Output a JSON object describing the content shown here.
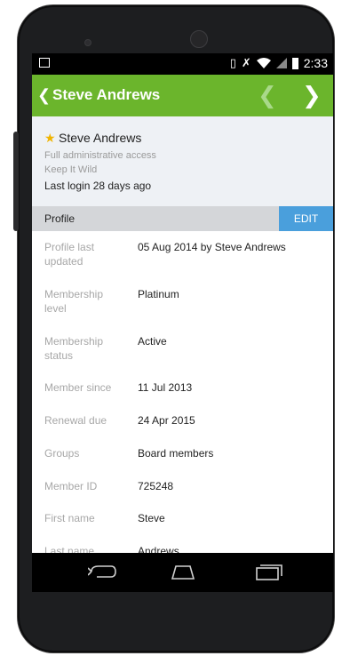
{
  "status_bar": {
    "time": "2:33"
  },
  "app_bar": {
    "back_glyph": "❮",
    "title": "Steve Andrews",
    "prev_glyph": "❮",
    "next_glyph": "❯",
    "color": "#6bb52c"
  },
  "user_card": {
    "star_icon": "star-icon",
    "star_color": "#f0b400",
    "name": "Steve Andrews",
    "access": "Full administrative access",
    "organization": "Keep It Wild",
    "last_login": "Last login 28 days ago"
  },
  "section": {
    "title": "Profile",
    "edit_label": "EDIT",
    "edit_color": "#4a9fdc"
  },
  "profile_rows": [
    {
      "label": "Profile last updated",
      "value": "05 Aug 2014 by Steve Andrews"
    },
    {
      "label": "Membership level",
      "value": "Platinum"
    },
    {
      "label": "Membership status",
      "value": "Active"
    },
    {
      "label": "Member since",
      "value": "11 Jul 2013"
    },
    {
      "label": "Renewal due",
      "value": "24 Apr 2015"
    },
    {
      "label": "Groups",
      "value": "Board members"
    },
    {
      "label": "Member ID",
      "value": "725248"
    },
    {
      "label": "First name",
      "value": "Steve"
    },
    {
      "label": "Last name",
      "value": "Andrews"
    }
  ],
  "nav_bar": {
    "icons": [
      "back-nav-icon",
      "home-nav-icon",
      "recent-apps-icon"
    ]
  }
}
